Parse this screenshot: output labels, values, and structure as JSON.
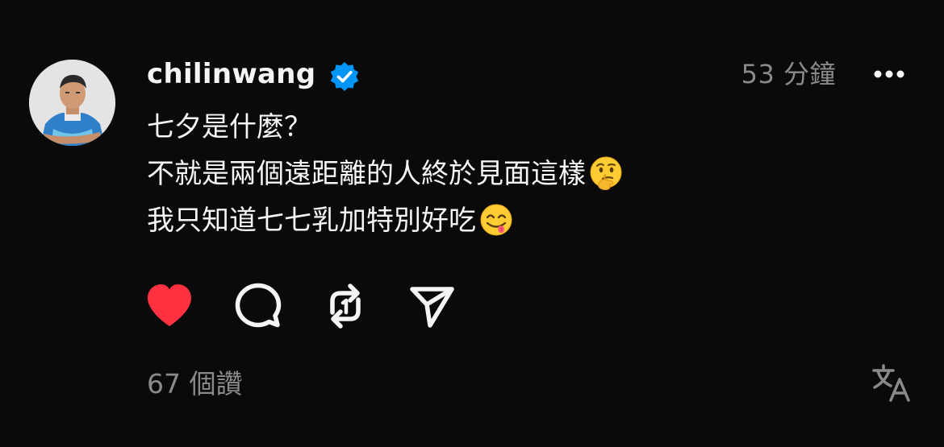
{
  "post": {
    "username": "chilinwang",
    "verified": true,
    "timestamp": "53 分鐘",
    "lines": [
      {
        "text": "七夕是什麼？",
        "emoji": null
      },
      {
        "text": "不就是兩個遠距離的人終於見面這樣",
        "emoji": "thinking-face"
      },
      {
        "text": "我只知道七七乳加特別好吃",
        "emoji": "face-savoring-food"
      }
    ],
    "likes": "67 個讚",
    "liked": true
  },
  "icons": {
    "like": "heart-icon",
    "comment": "comment-icon",
    "repost": "repost-icon",
    "share": "send-icon",
    "more": "more-icon",
    "translate": "translate-icon",
    "verified": "verified-badge-icon"
  },
  "colors": {
    "background": "#0a0a0a",
    "text": "#f3f5f7",
    "secondary": "#8a8a8a",
    "like": "#ff3040",
    "verified": "#0095f6"
  }
}
